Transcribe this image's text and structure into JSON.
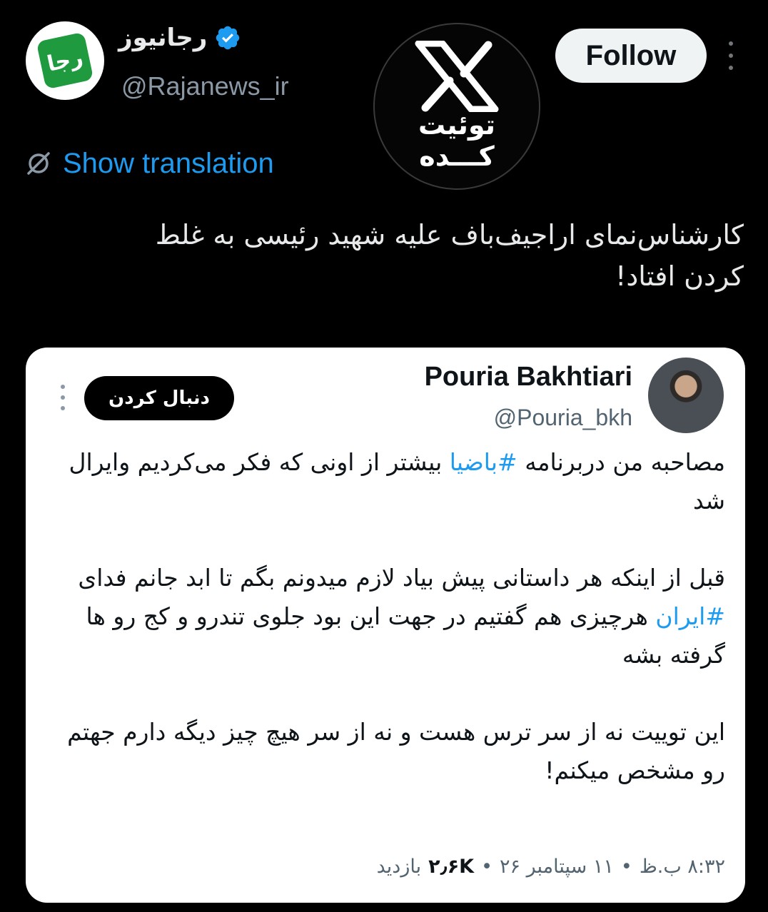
{
  "author": {
    "display_name": "رجانیوز",
    "handle": "@Rajanews_ir",
    "logo_text": "رجا",
    "verified": true
  },
  "watermark": {
    "line1": "توئیت",
    "line2": "کـــده"
  },
  "follow_label": "Follow",
  "show_translation_label": "Show translation",
  "tweet": {
    "line1": "کارشناس‌نمای اراجیف‌باف علیه شهید رئیسی به غلط",
    "line2": "کردن افتاد!"
  },
  "quoted": {
    "name": "Pouria Bakhtiari",
    "handle": "@Pouria_bkh",
    "follow_label": "دنبال کردن",
    "para1_before": "مصاحبه من دربرنامه ",
    "para1_hashtag": "#باضیا",
    "para1_after": " بیشتر از اونی که فکر می‌کردیم وایرال شد",
    "para2_before": "قبل از اینکه هر داستانی پیش بیاد لازم میدونم بگم تا ابد جانم فدای ",
    "para2_hashtag": "#ایران",
    "para2_after": " هرچیزی هم گفتیم در جهت این بود جلوی تندرو و کج رو ها گرفته بشه",
    "para3": "این توییت نه از سر ترس هست و نه از سر هیچ چیز دیگه دارم جهتم رو مشخص میکنم!",
    "meta_time": "۸:۳۲ ب.ظ",
    "meta_date": "۱۱ سپتامبر ۲۶",
    "meta_views": "۲٫۶K",
    "meta_views_label": "بازدید",
    "meta_sep": "•"
  },
  "colors": {
    "background": "#000000",
    "link_blue": "#1d9bf0",
    "logo_green": "#1f9a3e",
    "card_bg": "#ffffff"
  },
  "icons": [
    "verified-badge-icon",
    "more-icon",
    "translate-icon"
  ]
}
